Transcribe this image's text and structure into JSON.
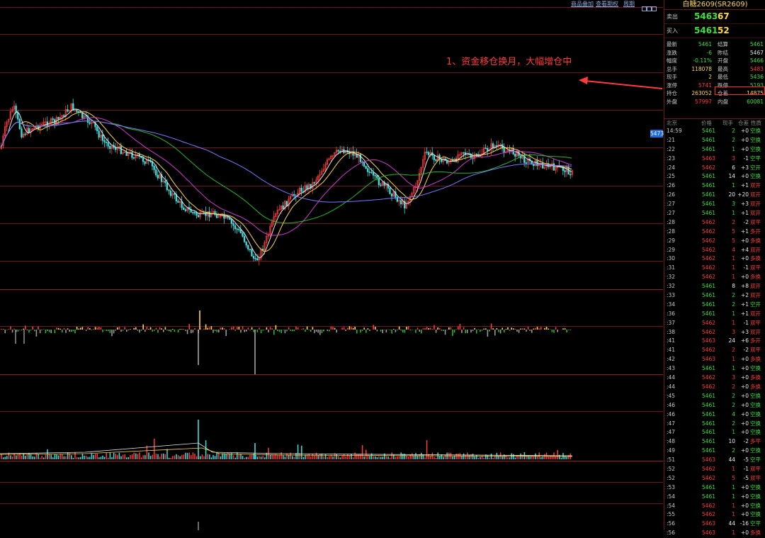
{
  "toolbar": {
    "links": [
      "商品叠加",
      "查看期权",
      "周期"
    ]
  },
  "annotation": "1、资金移仓换月，大幅增仓中",
  "price_tag": "5473",
  "panel": {
    "title": "白糖2609(SR2609)",
    "sell_label": "卖出",
    "sell_price": "5463",
    "sell_vol": "67",
    "buy_label": "买入",
    "buy_price": "5461",
    "buy_vol": "52",
    "stats": [
      {
        "l1": "最新",
        "v1": "5461",
        "c1": "grn",
        "l2": "结算",
        "v2": "5461",
        "c2": "grn"
      },
      {
        "l1": "涨跌",
        "v1": "-6",
        "c1": "grn",
        "l2": "昨结",
        "v2": "5467",
        "c2": "wht"
      },
      {
        "l1": "幅度",
        "v1": "-0.11%",
        "c1": "grn",
        "l2": "开盘",
        "v2": "5466",
        "c2": "grn"
      },
      {
        "l1": "总手",
        "v1": "118078",
        "c1": "yel",
        "l2": "最高",
        "v2": "5483",
        "c2": "red"
      },
      {
        "l1": "现手",
        "v1": "2",
        "c1": "yel",
        "l2": "最低",
        "v2": "5436",
        "c2": "grn"
      },
      {
        "l1": "涨停",
        "v1": "5741",
        "c1": "red",
        "l2": "跌停",
        "v2": "5193",
        "c2": "grn"
      },
      {
        "l1": "持仓",
        "v1": "263052",
        "c1": "yel",
        "l2": "仓差",
        "v2": "14875",
        "c2": "yel"
      },
      {
        "l1": "外盘",
        "v1": "57997",
        "c1": "red",
        "l2": "内盘",
        "v2": "60081",
        "c2": "grn"
      }
    ],
    "ticks_header": [
      "北京",
      "价格",
      "现手",
      "仓差",
      "性质"
    ],
    "ticks": [
      {
        "t": "14:59",
        "p": "5461",
        "v": "2",
        "o": "+0",
        "n": "空换"
      },
      {
        "t": ":21",
        "p": "5461",
        "v": "2",
        "o": "+0",
        "n": "空换"
      },
      {
        "t": ":22",
        "p": "5461",
        "v": "1",
        "o": "+0",
        "n": "空换"
      },
      {
        "t": ":23",
        "p": "5463",
        "v": "3",
        "o": "-1",
        "n": "空平"
      },
      {
        "t": ":24",
        "p": "5462",
        "v": "6",
        "o": "+3",
        "n": "空开"
      },
      {
        "t": ":25",
        "p": "5461",
        "v": "14",
        "o": "+0",
        "n": "空换"
      },
      {
        "t": ":26",
        "p": "5461",
        "v": "1",
        "o": "+1",
        "n": "双开"
      },
      {
        "t": ":26",
        "p": "5461",
        "v": "20",
        "o": "+20",
        "n": "双开"
      },
      {
        "t": ":27",
        "p": "5461",
        "v": "3",
        "o": "+3",
        "n": "双开"
      },
      {
        "t": ":27",
        "p": "5461",
        "v": "1",
        "o": "+1",
        "n": "双开"
      },
      {
        "t": ":28",
        "p": "5462",
        "v": "2",
        "o": "-2",
        "n": "双平"
      },
      {
        "t": ":28",
        "p": "5462",
        "v": "5",
        "o": "+1",
        "n": "多开"
      },
      {
        "t": ":29",
        "p": "5462",
        "v": "5",
        "o": "+0",
        "n": "多换"
      },
      {
        "t": ":29",
        "p": "5462",
        "v": "4",
        "o": "+4",
        "n": "双开"
      },
      {
        "t": ":30",
        "p": "5462",
        "v": "1",
        "o": "+0",
        "n": "多换"
      },
      {
        "t": ":31",
        "p": "5462",
        "v": "1",
        "o": "-1",
        "n": "双平"
      },
      {
        "t": ":32",
        "p": "5462",
        "v": "1",
        "o": "+0",
        "n": "多换"
      },
      {
        "t": ":32",
        "p": "5461",
        "v": "8",
        "o": "+8",
        "n": "双开"
      },
      {
        "t": ":33",
        "p": "5461",
        "v": "2",
        "o": "+2",
        "n": "双开"
      },
      {
        "t": ":34",
        "p": "5461",
        "v": "2",
        "o": "+1",
        "n": "空开"
      },
      {
        "t": ":36",
        "p": "5461",
        "v": "1",
        "o": "+1",
        "n": "双开"
      },
      {
        "t": ":37",
        "p": "5462",
        "v": "1",
        "o": "-1",
        "n": "双平"
      },
      {
        "t": ":38",
        "p": "5462",
        "v": "3",
        "o": "+3",
        "n": "双开"
      },
      {
        "t": ":41",
        "p": "5463",
        "v": "24",
        "o": "+6",
        "n": "多开"
      },
      {
        "t": ":41",
        "p": "5462",
        "v": "2",
        "o": "-2",
        "n": "双平"
      },
      {
        "t": ":42",
        "p": "5463",
        "v": "1",
        "o": "+0",
        "n": "多换"
      },
      {
        "t": ":43",
        "p": "5461",
        "v": "1",
        "o": "+0",
        "n": "空换"
      },
      {
        "t": ":44",
        "p": "5462",
        "v": "3",
        "o": "+0",
        "n": "多换"
      },
      {
        "t": ":44",
        "p": "5462",
        "v": "2",
        "o": "+0",
        "n": "多换"
      },
      {
        "t": ":45",
        "p": "5461",
        "v": "2",
        "o": "+0",
        "n": "空换"
      },
      {
        "t": ":46",
        "p": "5461",
        "v": "2",
        "o": "+0",
        "n": "空换"
      },
      {
        "t": ":46",
        "p": "5461",
        "v": "4",
        "o": "+0",
        "n": "空换"
      },
      {
        "t": ":47",
        "p": "5461",
        "v": "2",
        "o": "+0",
        "n": "空换"
      },
      {
        "t": ":47",
        "p": "5461",
        "v": "1",
        "o": "+0",
        "n": "空换"
      },
      {
        "t": ":48",
        "p": "5461",
        "v": "10",
        "o": "-2",
        "n": "多平"
      },
      {
        "t": ":49",
        "p": "5461",
        "v": "2",
        "o": "+0",
        "n": "空换"
      },
      {
        "t": ":51",
        "p": "5463",
        "v": "44",
        "o": "-5",
        "n": "空平"
      },
      {
        "t": ":52",
        "p": "5462",
        "v": "1",
        "o": "-1",
        "n": "双平"
      },
      {
        "t": ":52",
        "p": "5462",
        "v": "5",
        "o": "-5",
        "n": "双平"
      },
      {
        "t": ":53",
        "p": "5461",
        "v": "1",
        "o": "+0",
        "n": "空换"
      },
      {
        "t": ":54",
        "p": "5461",
        "v": "1",
        "o": "+0",
        "n": "空换"
      },
      {
        "t": ":54",
        "p": "5462",
        "v": "1",
        "o": "+0",
        "n": "空换"
      },
      {
        "t": ":55",
        "p": "5462",
        "v": "1",
        "o": "+0",
        "n": "空换"
      },
      {
        "t": ":56",
        "p": "5463",
        "v": "44",
        "o": "-16",
        "n": "空平"
      },
      {
        "t": ":56",
        "p": "5463",
        "v": "1",
        "o": "+0",
        "n": "多换"
      }
    ]
  },
  "colors": {
    "up": "#ff3b3b",
    "down": "#3ee0e0",
    "grid": "#6a1a1a",
    "annotation": "#ff3b3b"
  }
}
